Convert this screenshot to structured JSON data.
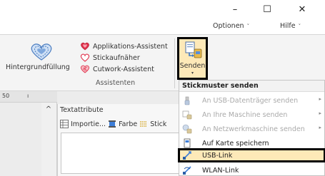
{
  "window": {
    "minimize_glyph": "–",
    "maximize_glyph": "☐",
    "close_glyph": "✕"
  },
  "menu": {
    "options_label": "Optionen",
    "help_label": "Hilfe",
    "caret": "˅"
  },
  "ribbon": {
    "hintergrund_label": "Hintergrundfüllung",
    "assistants": [
      {
        "label": "Applikations-Assistent",
        "icon": "heart-filled-icon"
      },
      {
        "label": "Stickaufnäher",
        "icon": "heart-outline-icon"
      },
      {
        "label": "Cutwork-Assistent",
        "icon": "heart-cutwork-icon"
      }
    ],
    "group_label": "Assistenten",
    "senden_label": "Senden",
    "senden_caret": "▾"
  },
  "lower": {
    "ruler_value": "50",
    "ruler_tick": "ı",
    "scroll_up_glyph": "^",
    "textattr_title": "Textattribute",
    "toolbar": {
      "import_label": "Importie...",
      "color_label": "Farbe",
      "stitch_label": "Stick"
    }
  },
  "dropdown": {
    "header": "Stickmuster senden",
    "items": [
      {
        "label": "An USB-Datenträger senden",
        "enabled": false,
        "submenu": true,
        "icon": "usb-drive-icon"
      },
      {
        "label": "An Ihre Maschine senden",
        "enabled": false,
        "submenu": true,
        "icon": "machine-icon"
      },
      {
        "label": "An Netzwerkmaschine senden",
        "enabled": false,
        "submenu": true,
        "icon": "network-machine-icon"
      },
      {
        "label": "Auf Karte speichern",
        "enabled": true,
        "submenu": false,
        "icon": "card-icon"
      },
      {
        "label": "USB-Link",
        "enabled": true,
        "submenu": false,
        "icon": "usb-link-icon"
      },
      {
        "label": "WLAN-Link",
        "enabled": true,
        "submenu": false,
        "icon": "wlan-link-icon"
      }
    ],
    "submenu_arrow": "▸"
  },
  "colors": {
    "highlight_fill": "#fde9b8",
    "highlight_border": "#000000",
    "heart_red": "#e0304a",
    "ribbon_bg": "#f4f4f4"
  }
}
